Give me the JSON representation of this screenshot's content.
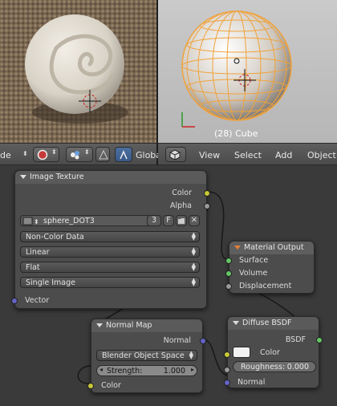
{
  "viewport_right": {
    "object_label": "(28) Cube"
  },
  "header_left": {
    "items": [
      {
        "name": "mode-dropdown",
        "label": "de"
      },
      {
        "name": "viewport-shading-dropdown",
        "label": ""
      },
      {
        "name": "pivot-dropdown",
        "label": ""
      },
      {
        "name": "transform-orientation",
        "label": "Globa"
      }
    ]
  },
  "header_right": {
    "menus": [
      "View",
      "Select",
      "Add",
      "Object"
    ]
  },
  "nodes": {
    "image_texture": {
      "title": "Image Texture",
      "outputs": [
        "Color",
        "Alpha"
      ],
      "image_name": "sphere_DOT3",
      "users": "3",
      "fake_user": "F",
      "color_space": "Non-Color Data",
      "interpolation": "Linear",
      "projection": "Flat",
      "source": "Single Image",
      "input": "Vector"
    },
    "material_output": {
      "title": "Material Output",
      "inputs": [
        "Surface",
        "Volume",
        "Displacement"
      ]
    },
    "normal_map": {
      "title": "Normal Map",
      "output": "Normal",
      "space": "Blender Object Space",
      "strength_label": "Strength:",
      "strength_value": "1.000",
      "input": "Color"
    },
    "diffuse_bsdf": {
      "title": "Diffuse BSDF",
      "output": "BSDF",
      "color_label": "Color",
      "roughness_label": "Roughness:",
      "roughness_value": "0.000",
      "normal_label": "Normal"
    }
  }
}
